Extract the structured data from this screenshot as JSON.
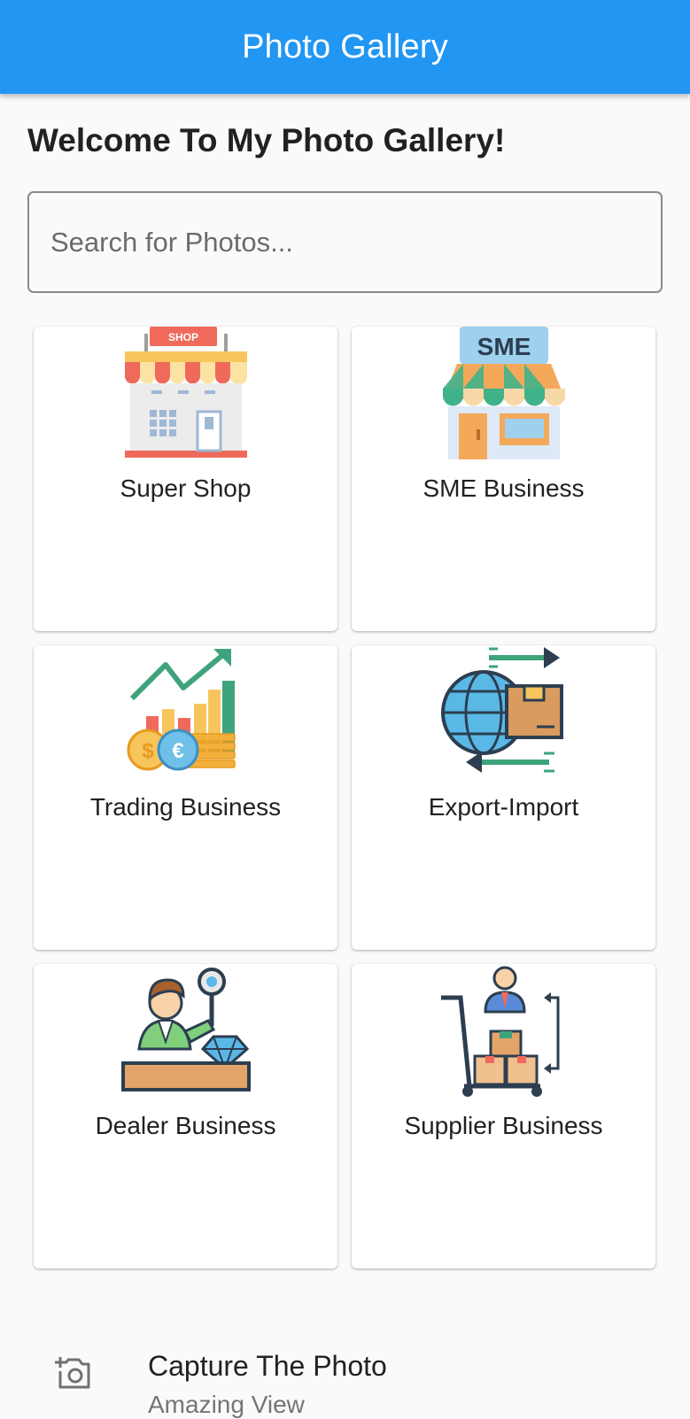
{
  "appbar": {
    "title": "Photo Gallery",
    "color": "#2196f3"
  },
  "welcome": "Welcome To My Photo Gallery!",
  "search": {
    "placeholder": "Search for Photos...",
    "value": ""
  },
  "cards": [
    {
      "label": "Super Shop",
      "icon": "shop-icon"
    },
    {
      "label": "SME Business",
      "icon": "sme-store-icon"
    },
    {
      "label": "Trading Business",
      "icon": "trading-chart-icon"
    },
    {
      "label": "Export-Import",
      "icon": "globe-shipping-icon"
    },
    {
      "label": "Dealer Business",
      "icon": "dealer-diamond-icon"
    },
    {
      "label": "Supplier Business",
      "icon": "supplier-cart-icon"
    }
  ],
  "shop_sign": "SHOP",
  "sme_sign": "SME",
  "list_tile": {
    "title": "Capture The Photo",
    "subtitle": "Amazing View",
    "icon": "add-photo-camera-icon"
  }
}
